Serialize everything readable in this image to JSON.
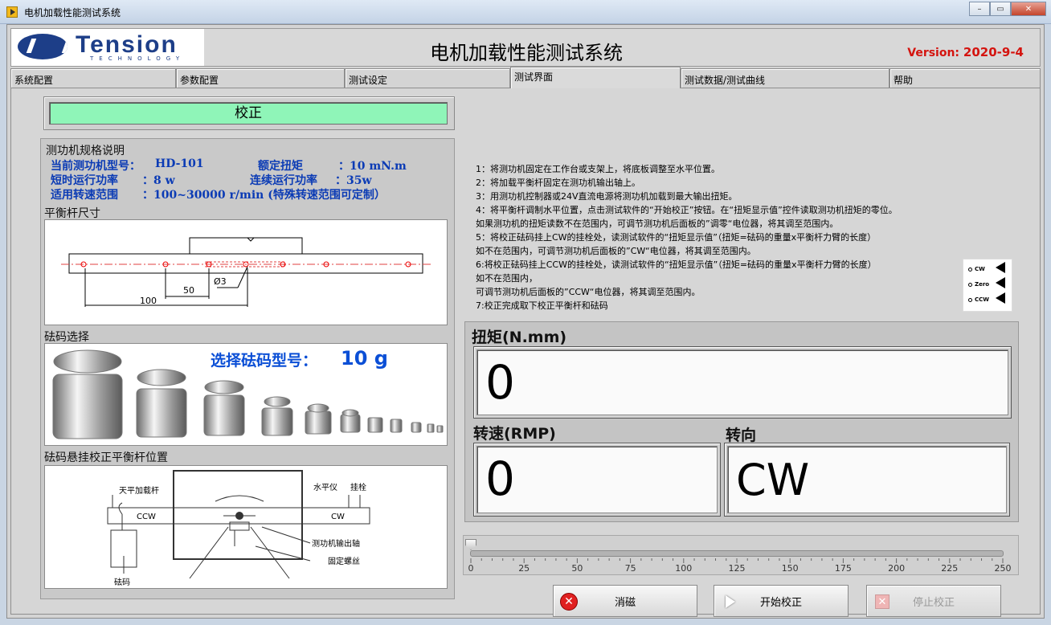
{
  "window": {
    "title": "电机加载性能测试系统"
  },
  "header": {
    "logo_word": "Tension",
    "logo_sub": "TECHNOLOGY",
    "title": "电机加载性能测试系统",
    "version_label": "Version:",
    "version_value": "2020-9-4"
  },
  "tabs": [
    "系统配置",
    "参数配置",
    "测试设定",
    "测试界面",
    "测试数据/测试曲线",
    "帮助"
  ],
  "calibration": {
    "label": "校正",
    "color": "#8ff5b8"
  },
  "specs": {
    "section_title": "测功机规格说明",
    "model_label": "当前测功机型号：",
    "model_value": "HD-101",
    "rated_torque_label": "额定扭矩",
    "rated_torque_value": "：10 mN.m",
    "short_power_label": "短时运行功率",
    "short_power_value": "：8 w",
    "cont_power_label": "连续运行功率",
    "cont_power_value": "：35w",
    "speed_range_label": "适用转速范围",
    "speed_range_value": "：100~30000 r/min (特殊转速范围可定制）"
  },
  "balance_bar": {
    "section_title": "平衡杆尺寸",
    "dim_diameter": "Ø3",
    "dim_50": "50",
    "dim_100": "100"
  },
  "weights": {
    "section_title": "砝码选择",
    "select_label": "选择砝码型号：",
    "select_value": "10 g"
  },
  "hanging": {
    "section_title": "砝码悬挂校正平衡杆位置",
    "lbl_bar": "天平加载杆",
    "lbl_level": "水平仪",
    "lbl_peg": "挂栓",
    "lbl_ccw": "CCW",
    "lbl_cw": "CW",
    "lbl_shaft": "测功机输出轴",
    "lbl_screw": "固定螺丝",
    "lbl_weight": "砝码"
  },
  "instructions": [
    "1：将测功机固定在工作台或支架上，将底板调整至水平位置。",
    "2：将加载平衡杆固定在测功机输出轴上。",
    "3：用测功机控制器或24V直流电源将测功机加载到最大输出扭矩。",
    "4：将平衡杆调制水平位置，点击测试软件的“开始校正”按钮。在“扭矩显示值”控件读取测功机扭矩的零位。",
    "如果测功机的扭矩读数不在范围内，可调节测功机后面板的”调零“电位器，将其调至范围内。",
    "5：将校正砝码挂上CW的挂栓处，读测试软件的“扭矩显示值”（扭矩=砝码的重量x平衡杆力臂的长度）",
    "如不在范围内，可调节测功机后面板的”CW“电位器，将其调至范围内。",
    "6:将校正砝码挂上CCW的挂栓处，读测试软件的“扭矩显示值”（扭矩=砝码的重量x平衡杆力臂的长度）",
    "如不在范围内，",
    "可调节测功机后面板的”CCW“电位器，将其调至范围内。",
    "7:校正完成取下校正平衡杆和砝码"
  ],
  "legend": {
    "cw": "CW",
    "zero": "Zero",
    "ccw": "CCW"
  },
  "indicators": {
    "torque": {
      "label": "扭矩(N.mm)",
      "value": "0"
    },
    "speed": {
      "label": "转速(RMP)",
      "value": "0"
    },
    "direction": {
      "label": "转向",
      "value": "CW"
    }
  },
  "slider": {
    "min": 0,
    "max": 250,
    "value": 0,
    "ticks": [
      "0",
      "25",
      "50",
      "75",
      "100",
      "125",
      "150",
      "175",
      "200",
      "225",
      "250"
    ]
  },
  "buttons": {
    "clear": "消磁",
    "start": "开始校正",
    "stop": "停止校正"
  },
  "colors": {
    "version": "#d4140f",
    "spec_text": "#0b3bb5",
    "brand": "#1d3e88",
    "clear_icon": "#e02020"
  }
}
